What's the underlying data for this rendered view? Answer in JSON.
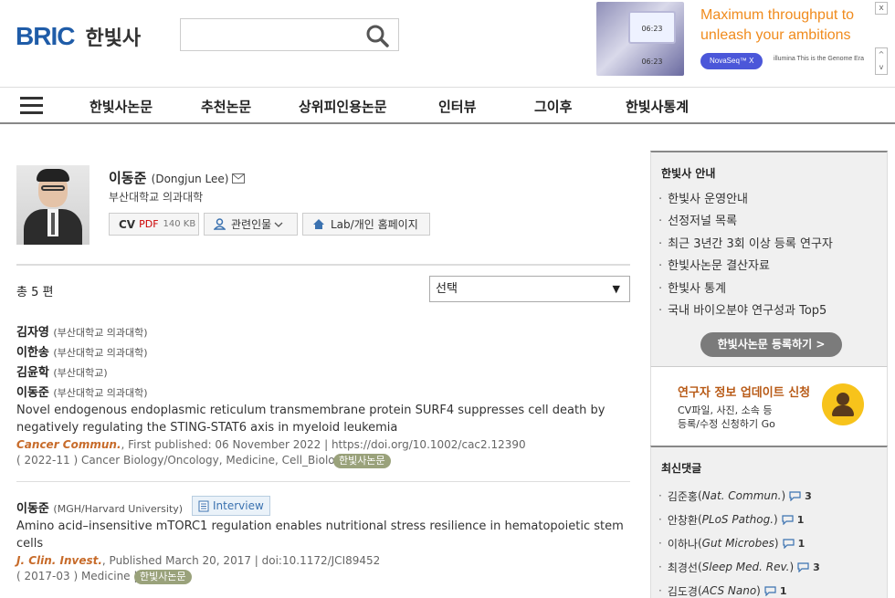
{
  "header": {
    "logo_bric": "BRIC",
    "logo_kor": "한빛사",
    "search_value": ""
  },
  "ad": {
    "screen_text": "06:23  06:23",
    "headline_1": "Maximum throughput to",
    "headline_2": "unleash your ambitions",
    "pill": "NovaSeq™ X",
    "brand": "illumina  This is the Genome Era",
    "close": "x",
    "up": "^",
    "down": "v"
  },
  "nav": {
    "items": [
      "한빛사논문",
      "추천논문",
      "상위피인용논문",
      "인터뷰",
      "그이후",
      "한빛사통계"
    ]
  },
  "profile": {
    "name": "이동준",
    "name_en": "(Dongjun Lee)",
    "affiliation": "부산대학교 의과대학",
    "cv_label": "CV",
    "cv_pdf": "PDF",
    "cv_size": "140 KB",
    "related_label": "관련인물",
    "lab_label": "Lab/개인 홈페이지"
  },
  "list_header": {
    "count": "총 5 편",
    "select_value": "선택"
  },
  "papers": [
    {
      "authors": [
        {
          "name": "김자영",
          "org": "(부산대학교 의과대학)"
        },
        {
          "name": "이한송",
          "org": "(부산대학교 의과대학)"
        },
        {
          "name": "김윤학",
          "org": "(부산대학교)"
        },
        {
          "name": "이동준",
          "org": "(부산대학교 의과대학)"
        }
      ],
      "title": "Novel endogenous endoplasmic reticulum transmembrane protein SURF4 suppresses cell death by negatively regulating the STING-STAT6 axis in myeloid leukemia",
      "journal": "Cancer Commun.",
      "pub": ", First published: 06 November 2022 | https://doi.org/10.1002/cac2.12390",
      "date_field": "( 2022-11 ) Cancer Biology/Oncology, Medicine, Cell_Biology |",
      "tag": "한빛사논문"
    },
    {
      "authors": [
        {
          "name": "이동준",
          "org": "(MGH/Harvard University)"
        }
      ],
      "interview": "Interview",
      "title": "Amino acid–insensitive mTORC1 regulation enables nutritional stress resilience in hematopoietic stem cells",
      "journal": "J. Clin. Invest.",
      "pub": ", Published March 20, 2017 | doi:10.1172/JCI89452",
      "date_field": "( 2017-03 ) Medicine |",
      "tag": "한빛사논문"
    }
  ],
  "sidebar": {
    "guide_title": "한빛사 안내",
    "guide_items": [
      "한빛사 운영안내",
      "선정저널 목록",
      "최근 3년간 3회 이상 등록 연구자",
      "한빛사논문 결산자료",
      "한빛사 통계",
      "국내 바이오분야 연구성과 Top5"
    ],
    "register_btn": "한빛사논문 등록하기 >",
    "update_title": "연구자 정보 업데이트 신청",
    "update_desc_1": "CV파일, 사진, 소속 등",
    "update_desc_2": "등록/수정 신청하기 Go",
    "comments_title": "최신댓글",
    "comments": [
      {
        "name": "김준홍",
        "journal": "Nat. Commun.",
        "count": "3"
      },
      {
        "name": "안창환",
        "journal": "PLoS Pathog.",
        "count": "1"
      },
      {
        "name": "이하나",
        "journal": "Gut Microbes",
        "count": "1"
      },
      {
        "name": "최경선",
        "journal": "Sleep Med. Rev.",
        "count": "3"
      },
      {
        "name": "김도경",
        "journal": "ACS Nano",
        "count": "1"
      }
    ]
  },
  "colors": {
    "brand_blue": "#1f5ca8",
    "ad_orange": "#f08b1d",
    "journal_orange": "#c76b2a",
    "tag_olive": "#9aa27b",
    "update_yellow": "#f7c31b"
  }
}
